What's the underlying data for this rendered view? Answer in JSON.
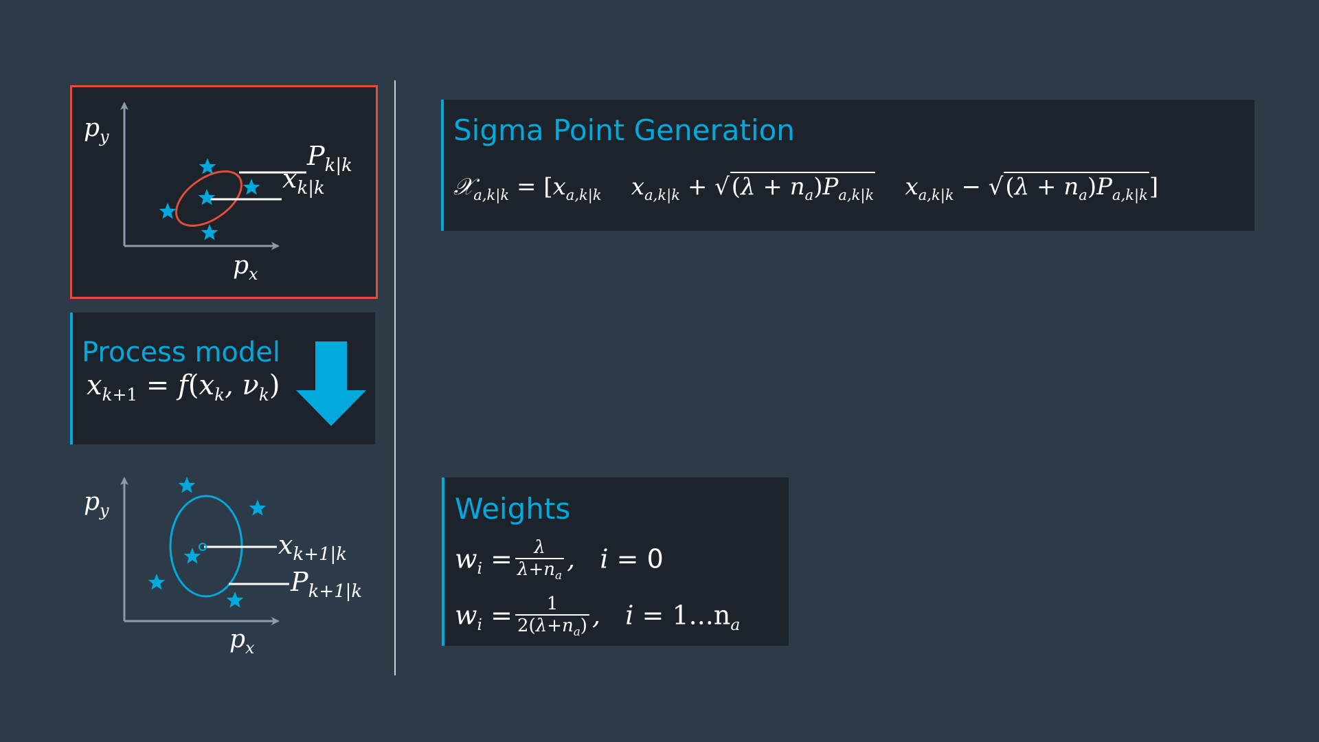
{
  "colors": {
    "background": "#2d3b49",
    "panel": "#1d232b",
    "accent": "#02a9dc",
    "highlight_border": "#e54c3c",
    "axis": "#8a9bb0",
    "ellipse_before": "#e54c3c",
    "ellipse_after": "#02a9dc"
  },
  "diagram_before": {
    "y_axis_label": "p",
    "y_axis_sub": "y",
    "x_axis_label": "p",
    "x_axis_sub": "x",
    "cov_label": "P",
    "cov_sub": "k|k",
    "mean_label": "x",
    "mean_sub": "k|k"
  },
  "process_model": {
    "title": "Process model",
    "equation": "x_{k+1} = f(x_k, ν_k)",
    "arrow_icon": "arrow-down-icon"
  },
  "diagram_after": {
    "y_axis_label": "p",
    "y_axis_sub": "y",
    "x_axis_label": "p",
    "x_axis_sub": "x",
    "mean_label": "x",
    "mean_sub": "k+1|k",
    "cov_label": "P",
    "cov_sub": "k+1|k"
  },
  "sigma_point_generation": {
    "title": "Sigma Point Generation",
    "equation": "𝒳_{a,k|k} = [x_{a,k|k}  x_{a,k|k} + √((λ+n_a)P_{a,k|k})  x_{a,k|k} − √((λ+n_a)P_{a,k|k})]"
  },
  "weights": {
    "title": "Weights",
    "equation_1": "w_i = λ/(λ+n_a), i = 0",
    "equation_2": "w_i = 1/(2(λ+n_a)), i = 1...n_a",
    "i_zero": "0",
    "range": "1...n"
  }
}
